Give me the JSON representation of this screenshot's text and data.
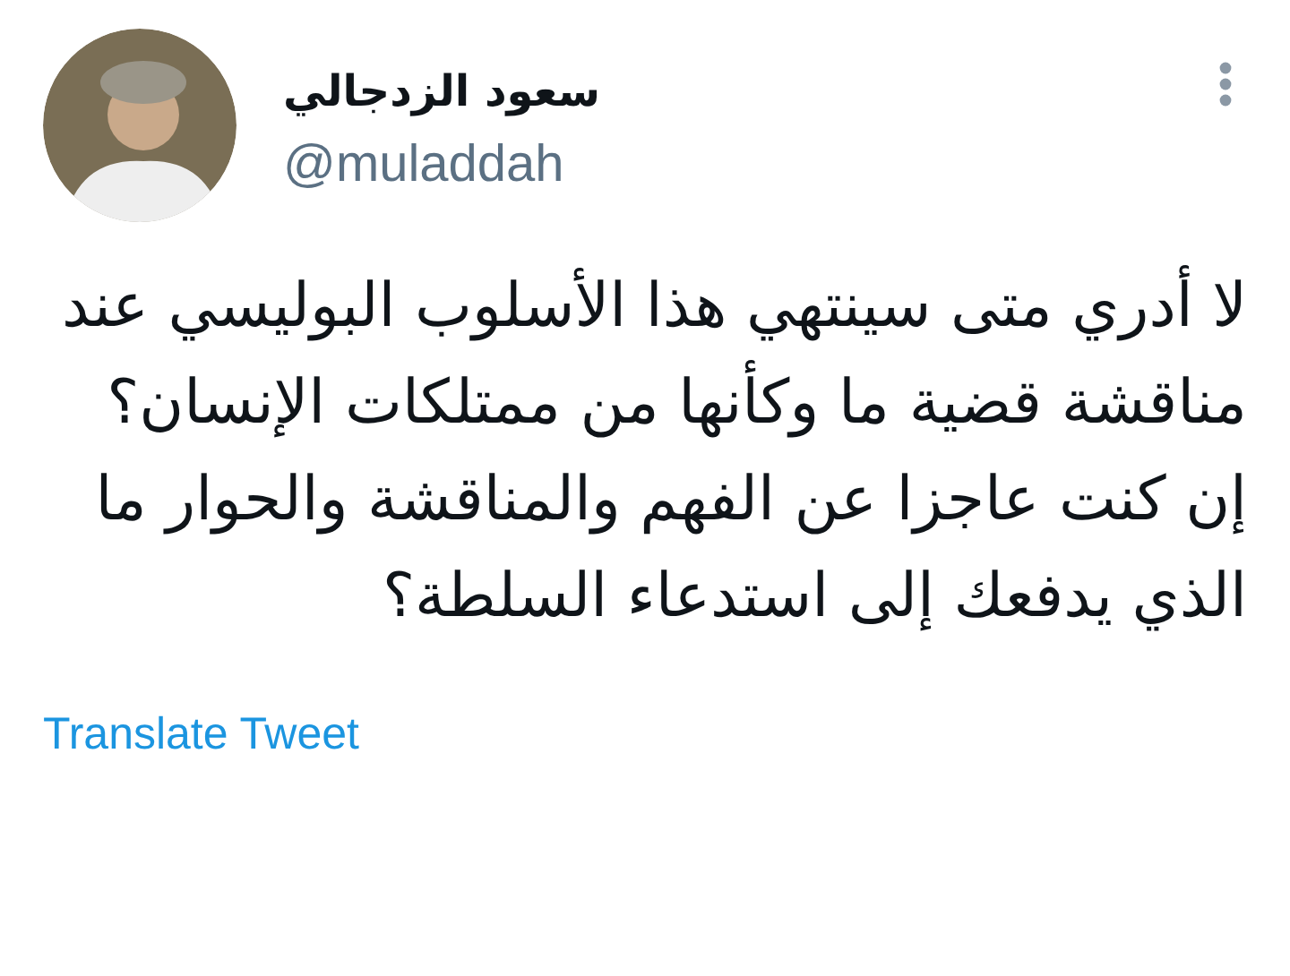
{
  "author": {
    "name": "سعود الزدجالي",
    "handle": "@muladdah"
  },
  "tweet": {
    "text": "لا أدري متى سينتهي هذا الأسلوب البوليسي عند مناقشة قضية ما وكأنها من ممتلكات الإنسان؟ إن كنت عاجزا عن الفهم والمناقشة والحوار ما الذي يدفعك إلى استدعاء السلطة؟"
  },
  "translate_link": "Translate Tweet"
}
